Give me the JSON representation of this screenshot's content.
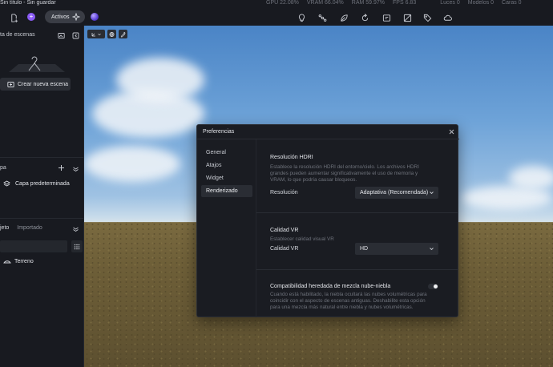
{
  "app": {
    "title": "Sin título - Sin guardar"
  },
  "stats": {
    "gpu": "GPU 22.08%",
    "vram": "VRAM 66.04%",
    "ram": "RAM 59.97%",
    "fps": "FPS 6.83",
    "lights": "Luces 0",
    "models": "Modelos 0",
    "faces": "Caras 0"
  },
  "toolbar": {
    "assets_label": "Activos",
    "accent_color": "#8b5cf6"
  },
  "left_panel": {
    "scenes_title": "ta de escenas",
    "create_scene_label": "Crear nueva escena",
    "layers_title": "pa",
    "default_layer_label": "Capa predeterminada",
    "objects_tab": "jeto",
    "imported_tab": "Importado",
    "terrain_label": "Terreno"
  },
  "modal": {
    "title": "Preferencias",
    "nav": [
      {
        "label": "General"
      },
      {
        "label": "Atajos"
      },
      {
        "label": "Widget"
      },
      {
        "label": "Renderizado",
        "active": true
      }
    ],
    "hdri": {
      "heading": "Resolución HDRI",
      "description": "Establece la resolución HDRI del entorno/cielo. Los archivos HDRI grandes pueden aumentar significativamente el uso de memoria y VRAM, lo que podría causar bloqueos.",
      "row_label": "Resolución",
      "selected": "Adaptativa (Recomendada)"
    },
    "vr": {
      "heading": "Calidad VR",
      "description": "Establecer calidad visual VR",
      "row_label": "Calidad VR",
      "selected": "HD"
    },
    "fog": {
      "heading": "Compatibilidad heredada de mezcla nube-niebla",
      "description": "Cuando está habilitado, la niebla ocultará las nubes volumétricas para coincidir con el aspecto de escenas antiguas. Deshabilite esta opción para una mezcla más natural entre niebla y nubes volumétricas.",
      "enabled": false
    }
  }
}
